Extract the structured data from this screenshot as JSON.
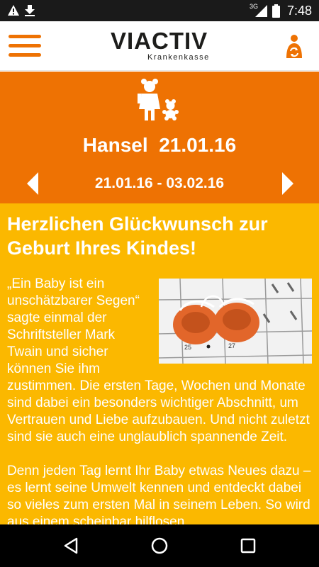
{
  "status_bar": {
    "network_label": "3G",
    "time": "7:48"
  },
  "app_bar": {
    "logo_name": "VIACTIV",
    "logo_subtitle": "Krankenkasse",
    "menu_icon": "hamburger-menu-icon",
    "profile_icon": "person-sync-icon",
    "accent_color": "#ee7203"
  },
  "hero": {
    "child_name": "Hansel",
    "birth_date": "21.01.16",
    "date_range": "21.01.16 - 03.02.16",
    "icon": "baby-with-teddy-icon",
    "background_color": "#ee7203"
  },
  "article": {
    "headline": "Herzlichen Glückwunsch zur Geburt Ihres Kindes!",
    "paragraph_1": "„Ein Baby ist ein unschätzbarer Segen“ sagte einmal der Schriftsteller Mark Twain und sicher können Sie ihm zustimmen. Die ersten Tage, Wochen und Monate sind dabei ein besonders wichtiger Abschnitt, um Vertrauen und Liebe aufzubauen. Und nicht zuletzt sind sie auch eine unglaublich spannende Zeit.",
    "paragraph_2": "Denn jeden Tag lernt Ihr Baby etwas Neues dazu – es lernt seine Umwelt kennen und entdeckt dabei so vieles zum ersten Mal in seinem Leben. So wird aus einem scheinbar hilflosen",
    "background_color": "#fbb800"
  },
  "nav_bar": {
    "back_icon": "back-triangle-icon",
    "home_icon": "home-circle-icon",
    "recent_icon": "recent-apps-square-icon"
  }
}
